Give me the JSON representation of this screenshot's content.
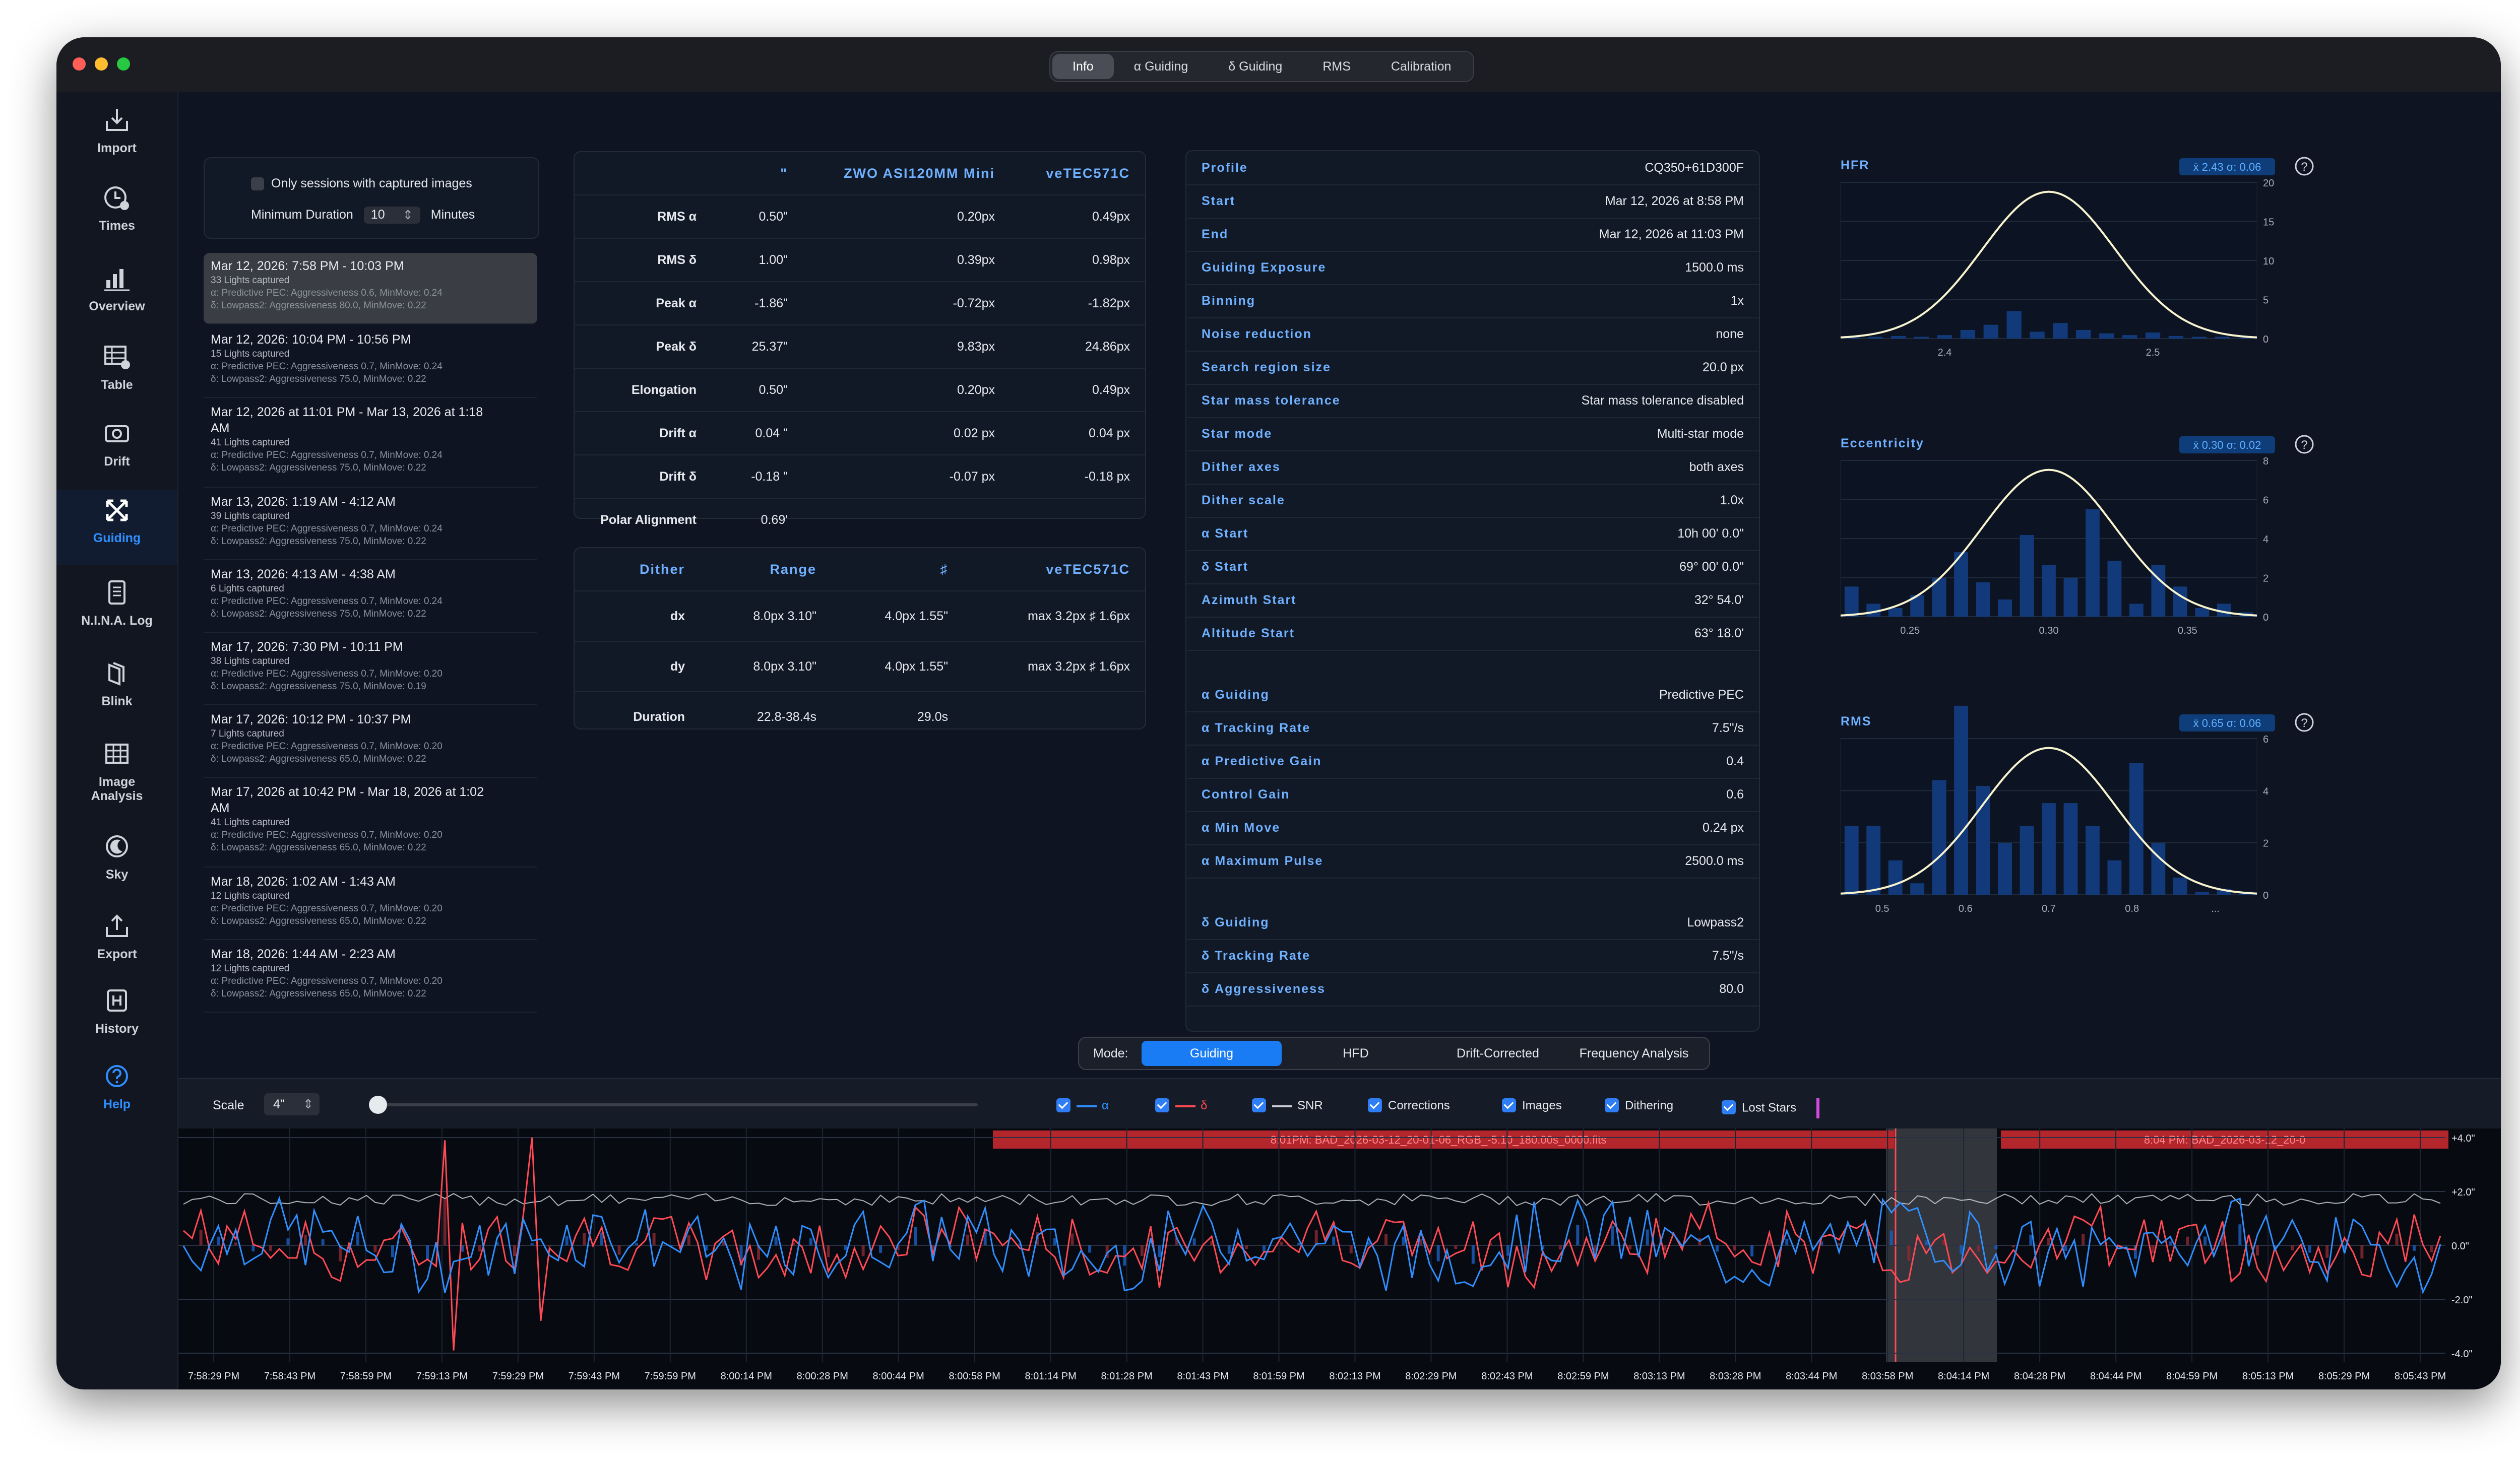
{
  "window": {
    "tabs": [
      {
        "label": "Info",
        "active": true
      },
      {
        "label": "α Guiding",
        "active": false
      },
      {
        "label": "δ Guiding",
        "active": false
      },
      {
        "label": "RMS",
        "active": false
      },
      {
        "label": "Calibration",
        "active": false
      }
    ]
  },
  "sidebar": {
    "items": [
      {
        "label": "Import",
        "icon": "import-tray-icon"
      },
      {
        "label": "Times",
        "icon": "clock-icon"
      },
      {
        "label": "Overview",
        "icon": "bar-chart-icon"
      },
      {
        "label": "Table",
        "icon": "table-icon"
      },
      {
        "label": "Drift",
        "icon": "camera-drift-icon"
      },
      {
        "label": "Guiding",
        "icon": "arrows-expand-icon"
      },
      {
        "label": "N.I.N.A. Log",
        "icon": "document-icon"
      },
      {
        "label": "Blink",
        "icon": "stacked-squares-icon"
      },
      {
        "label": "Image Analysis",
        "icon": "grid-icon"
      },
      {
        "label": "Sky",
        "icon": "moon-icon"
      },
      {
        "label": "Export",
        "icon": "export-tray-icon"
      },
      {
        "label": "History",
        "icon": "history-h-icon"
      },
      {
        "label": "Help",
        "icon": "question-circle-icon"
      }
    ]
  },
  "filter": {
    "only_captured_label": "Only sessions with captured images",
    "min_duration_label": "Minimum Duration",
    "min_duration_value": "10",
    "minutes_label": "Minutes"
  },
  "sessions": [
    {
      "title": "Mar 12, 2026: 7:58 PM - 10:03 PM",
      "lights": "33 Lights captured",
      "alpha": "α: Predictive PEC: Aggressiveness 0.6, MinMove: 0.24",
      "delta": "δ: Lowpass2: Aggressiveness 80.0, MinMove: 0.22",
      "selected": true
    },
    {
      "title": "Mar 12, 2026: 10:04 PM - 10:56 PM",
      "lights": "15 Lights captured",
      "alpha": "α: Predictive PEC: Aggressiveness 0.7, MinMove: 0.24",
      "delta": "δ: Lowpass2: Aggressiveness 75.0, MinMove: 0.22"
    },
    {
      "title": "Mar 12, 2026 at 11:01 PM - Mar 13, 2026 at 1:18 AM",
      "lights": "41 Lights captured",
      "alpha": "α: Predictive PEC: Aggressiveness 0.7, MinMove: 0.24",
      "delta": "δ: Lowpass2: Aggressiveness 75.0, MinMove: 0.22"
    },
    {
      "title": "Mar 13, 2026: 1:19 AM - 4:12 AM",
      "lights": "39 Lights captured",
      "alpha": "α: Predictive PEC: Aggressiveness 0.7, MinMove: 0.24",
      "delta": "δ: Lowpass2: Aggressiveness 75.0, MinMove: 0.22"
    },
    {
      "title": "Mar 13, 2026: 4:13 AM - 4:38 AM",
      "lights": "6 Lights captured",
      "alpha": "α: Predictive PEC: Aggressiveness 0.7, MinMove: 0.24",
      "delta": "δ: Lowpass2: Aggressiveness 75.0, MinMove: 0.22"
    },
    {
      "title": "Mar 17, 2026: 7:30 PM - 10:11 PM",
      "lights": "38 Lights captured",
      "alpha": "α: Predictive PEC: Aggressiveness 0.7, MinMove: 0.20",
      "delta": "δ: Lowpass2: Aggressiveness 75.0, MinMove: 0.19"
    },
    {
      "title": "Mar 17, 2026: 10:12 PM - 10:37 PM",
      "lights": "7 Lights captured",
      "alpha": "α: Predictive PEC: Aggressiveness 0.7, MinMove: 0.20",
      "delta": "δ: Lowpass2: Aggressiveness 65.0, MinMove: 0.22"
    },
    {
      "title": "Mar 17, 2026 at 10:42 PM - Mar 18, 2026 at 1:02 AM",
      "lights": "41 Lights captured",
      "alpha": "α: Predictive PEC: Aggressiveness 0.7, MinMove: 0.20",
      "delta": "δ: Lowpass2: Aggressiveness 65.0, MinMove: 0.22"
    },
    {
      "title": "Mar 18, 2026: 1:02 AM - 1:43 AM",
      "lights": "12 Lights captured",
      "alpha": "α: Predictive PEC: Aggressiveness 0.7, MinMove: 0.20",
      "delta": "δ: Lowpass2: Aggressiveness 65.0, MinMove: 0.22"
    },
    {
      "title": "Mar 18, 2026: 1:44 AM - 2:23 AM",
      "lights": "12 Lights captured",
      "alpha": "α: Predictive PEC: Aggressiveness 0.7, MinMove: 0.20",
      "delta": "δ: Lowpass2: Aggressiveness 65.0, MinMove: 0.22"
    }
  ],
  "stats_table": {
    "headers": [
      "\"",
      "ZWO ASI120MM Mini",
      "veTEC571C"
    ],
    "rows": [
      {
        "label": "RMS α",
        "c1": "0.50\"",
        "c2": "0.20px",
        "c3": "0.49px"
      },
      {
        "label": "RMS δ",
        "c1": "1.00\"",
        "c2": "0.39px",
        "c3": "0.98px"
      },
      {
        "label": "Peak α",
        "c1": "-1.86\"",
        "c2": "-0.72px",
        "c3": "-1.82px"
      },
      {
        "label": "Peak δ",
        "c1": "25.37\"",
        "c2": "9.83px",
        "c3": "24.86px"
      },
      {
        "label": "Elongation",
        "c1": "0.50\"",
        "c2": "0.20px",
        "c3": "0.49px"
      },
      {
        "label": "Drift α",
        "c1": "0.04 \"",
        "c2": "0.02 px",
        "c3": "0.04 px"
      },
      {
        "label": "Drift δ",
        "c1": "-0.18 \"",
        "c2": "-0.07 px",
        "c3": "-0.18 px"
      },
      {
        "label": "Polar Alignment",
        "c1": "0.69'",
        "c2": "",
        "c3": ""
      }
    ]
  },
  "dither_table": {
    "headers": [
      "Dither",
      "Range",
      "♯",
      "veTEC571C"
    ],
    "rows": [
      {
        "label": "dx",
        "c1": "8.0px 3.10\"",
        "c2": "4.0px 1.55\"",
        "c3": "max 3.2px ♯ 1.6px"
      },
      {
        "label": "dy",
        "c1": "8.0px 3.10\"",
        "c2": "4.0px 1.55\"",
        "c3": "max 3.2px ♯ 1.6px"
      },
      {
        "label": "Duration",
        "c1": "22.8-38.4s",
        "c2": "29.0s",
        "c3": ""
      }
    ]
  },
  "info": [
    {
      "k": "Profile",
      "v": "CQ350+61D300F"
    },
    {
      "k": "Start",
      "v": "Mar 12, 2026 at 8:58 PM"
    },
    {
      "k": "End",
      "v": "Mar 12, 2026 at 11:03 PM"
    },
    {
      "k": "Guiding Exposure",
      "v": "1500.0 ms"
    },
    {
      "k": "Binning",
      "v": "1x"
    },
    {
      "k": "Noise reduction",
      "v": "none"
    },
    {
      "k": "Search region size",
      "v": "20.0 px"
    },
    {
      "k": "Star mass tolerance",
      "v": "Star mass tolerance disabled"
    },
    {
      "k": "Star mode",
      "v": "Multi-star mode"
    },
    {
      "k": "Dither axes",
      "v": "both axes"
    },
    {
      "k": "Dither scale",
      "v": "1.0x"
    },
    {
      "k": "α Start",
      "v": "10h 00' 0.0\""
    },
    {
      "k": "δ Start",
      "v": "69° 00' 0.0\""
    },
    {
      "k": "Azimuth Start",
      "v": "32° 54.0'"
    },
    {
      "k": "Altitude Start",
      "v": "63° 18.0'"
    },
    {
      "k": "α Guiding",
      "v": "Predictive PEC"
    },
    {
      "k": "α Tracking Rate",
      "v": "7.5\"/s"
    },
    {
      "k": "α Predictive Gain",
      "v": "0.4"
    },
    {
      "k": "Control Gain",
      "v": "0.6"
    },
    {
      "k": "α Min Move",
      "v": "0.24 px"
    },
    {
      "k": "α Maximum Pulse",
      "v": "2500.0 ms"
    },
    {
      "k": "δ Guiding",
      "v": "Lowpass2"
    },
    {
      "k": "δ Tracking Rate",
      "v": "7.5\"/s"
    },
    {
      "k": "δ Aggressiveness",
      "v": "80.0"
    }
  ],
  "histograms": [
    {
      "title": "HFR",
      "badge": "x̄ 2.43 σ: 0.06",
      "xticks": [
        "2.4",
        "2.5"
      ],
      "yticks": [
        "20",
        "15",
        "10",
        "5",
        "0"
      ]
    },
    {
      "title": "Eccentricity",
      "badge": "x̄ 0.30 σ: 0.02",
      "xticks": [
        "0.25",
        "0.30",
        "0.35"
      ],
      "yticks": [
        "8",
        "6",
        "4",
        "2",
        "0"
      ]
    },
    {
      "title": "RMS",
      "badge": "x̄ 0.65 σ: 0.06",
      "xticks": [
        "0.5",
        "0.6",
        "0.7",
        "0.8",
        "..."
      ],
      "yticks": [
        "6",
        "4",
        "2",
        "0"
      ]
    }
  ],
  "mode": {
    "label": "Mode:",
    "options": [
      {
        "label": "Guiding",
        "active": true
      },
      {
        "label": "HFD",
        "active": false
      },
      {
        "label": "Drift-Corrected",
        "active": false
      },
      {
        "label": "Frequency Analysis",
        "active": false
      }
    ]
  },
  "controls": {
    "scale_label": "Scale",
    "scale_value": "4\"",
    "legend": [
      {
        "label": "α",
        "color": "#2f8fff"
      },
      {
        "label": "δ",
        "color": "#ff4a55"
      },
      {
        "label": "SNR",
        "color": "#c8ccd3"
      },
      {
        "label": "Corrections",
        "color": ""
      },
      {
        "label": "Images",
        "color": ""
      },
      {
        "label": "Dithering",
        "color": ""
      },
      {
        "label": "Lost Stars",
        "color": "#d24be0"
      }
    ]
  },
  "chart_data": {
    "type": "line",
    "banners": [
      "8:01PM: BAD_2026-03-12_20-01-06_RGB_-5.10_180.00s_0000.fits",
      "8:04 PM: BAD_2026-03-12_20-0"
    ],
    "yticks": [
      "+4.0\"",
      "+2.0\"",
      "0.0\"",
      "-2.0\"",
      "-4.0\""
    ],
    "ylim": [
      -4,
      4
    ],
    "xticks": [
      "7:58:29 PM",
      "7:58:43 PM",
      "7:58:59 PM",
      "7:59:13 PM",
      "7:59:29 PM",
      "7:59:43 PM",
      "7:59:59 PM",
      "8:00:14 PM",
      "8:00:28 PM",
      "8:00:44 PM",
      "8:00:58 PM",
      "8:01:14 PM",
      "8:01:28 PM",
      "8:01:43 PM",
      "8:01:59 PM",
      "8:02:13 PM",
      "8:02:29 PM",
      "8:02:43 PM",
      "8:02:59 PM",
      "8:03:13 PM",
      "8:03:28 PM",
      "8:03:44 PM",
      "8:03:58 PM",
      "8:04:14 PM",
      "8:04:28 PM",
      "8:04:44 PM",
      "8:04:59 PM",
      "8:05:13 PM",
      "8:05:29 PM",
      "8:05:43 PM"
    ],
    "series": [
      {
        "name": "α",
        "color": "#2f8fff"
      },
      {
        "name": "δ",
        "color": "#ff4a55"
      },
      {
        "name": "SNR",
        "color": "#c8ccd3"
      }
    ]
  },
  "colors": {
    "accent": "#2f8fff",
    "alpha": "#2f8fff",
    "delta": "#ff4a55",
    "badge_bg": "#0e3d7a",
    "window_bg": "#0d1220"
  }
}
